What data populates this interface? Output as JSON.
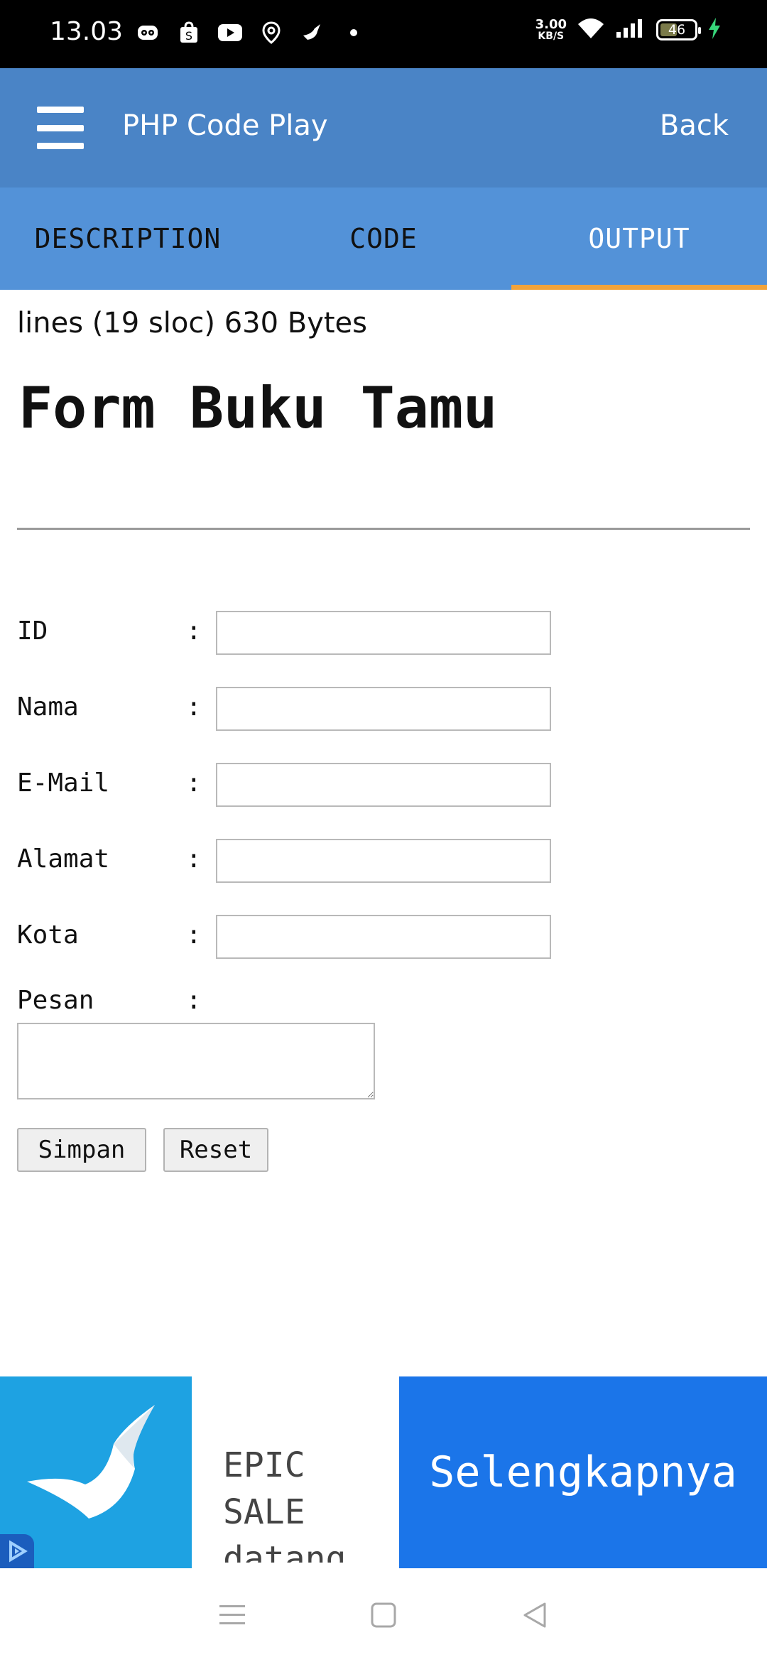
{
  "status_bar": {
    "time": "13.03",
    "net_speed_value": "3.00",
    "net_speed_unit": "KB/S",
    "battery_level": "46",
    "icons": [
      "pet-app-icon",
      "shopping-bag-icon",
      "youtube-icon",
      "map-pin-icon",
      "bird-app-icon",
      "dot-icon",
      "wifi-icon",
      "signal-icon",
      "battery-icon",
      "charging-icon"
    ]
  },
  "app_bar": {
    "title": "PHP Code Play",
    "back_label": "Back",
    "menu_icon": "hamburger-menu-icon"
  },
  "tabs": [
    {
      "label": "DESCRIPTION",
      "active": false
    },
    {
      "label": "CODE",
      "active": false
    },
    {
      "label": "OUTPUT",
      "active": true
    }
  ],
  "output": {
    "meta_line": "lines (19 sloc) 630 Bytes",
    "heading": "Form Buku Tamu",
    "fields": [
      {
        "label": "ID",
        "colon": ":",
        "value": ""
      },
      {
        "label": "Nama",
        "colon": ":",
        "value": ""
      },
      {
        "label": "E-Mail",
        "colon": ":",
        "value": ""
      },
      {
        "label": "Alamat",
        "colon": ":",
        "value": ""
      },
      {
        "label": "Kota",
        "colon": ":",
        "value": ""
      }
    ],
    "message": {
      "label": "Pesan",
      "colon": ":",
      "value": ""
    },
    "buttons": {
      "save": "Simpan",
      "reset": "Reset"
    }
  },
  "ad": {
    "text": "EPIC SALE datang",
    "cta": "Selengkapnya",
    "brand_color": "#1ea2e2",
    "cta_color": "#1b75e9"
  },
  "nav_bar": {
    "icons": [
      "recent-apps-icon",
      "home-icon",
      "back-icon"
    ]
  },
  "colors": {
    "app_bar": "#4a84c6",
    "tab_bar": "#5392d8",
    "tab_indicator": "#f2a33a"
  }
}
